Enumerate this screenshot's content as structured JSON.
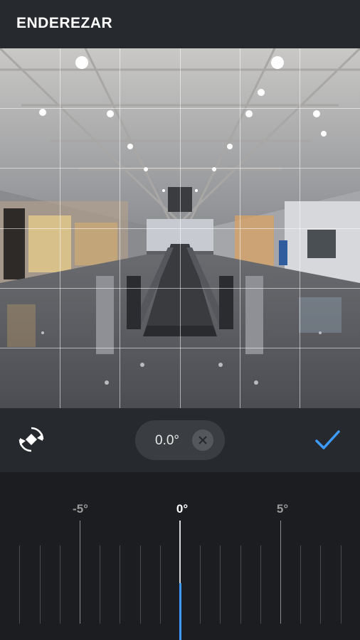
{
  "header": {
    "title": "ENDEREZAR"
  },
  "controls": {
    "rotate_icon": "rotate-icon",
    "angle_value": "0.0°",
    "reset_icon": "close-icon",
    "confirm_icon": "checkmark-icon",
    "accent_color": "#3d9bff"
  },
  "ruler": {
    "labels": {
      "minus5": "-5°",
      "zero": "0°",
      "plus5": "5°"
    },
    "current_angle": 0
  }
}
